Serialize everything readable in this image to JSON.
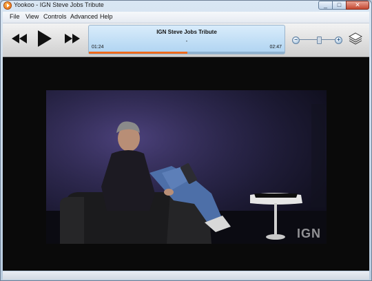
{
  "window": {
    "title": "Yookoo - IGN Steve Jobs Tribute"
  },
  "menu": [
    "File",
    "View",
    "Controls",
    "Advanced",
    "Help"
  ],
  "player": {
    "track_title": "IGN Steve Jobs Tribute",
    "track_sub": "-",
    "elapsed": "01:24",
    "duration": "02:47",
    "progress_fraction": 0.503,
    "volume_fraction": 0.55
  },
  "video": {
    "watermark": "IGN"
  },
  "colors": {
    "accent": "#ef6a1c",
    "panel": "#aed3f1"
  }
}
